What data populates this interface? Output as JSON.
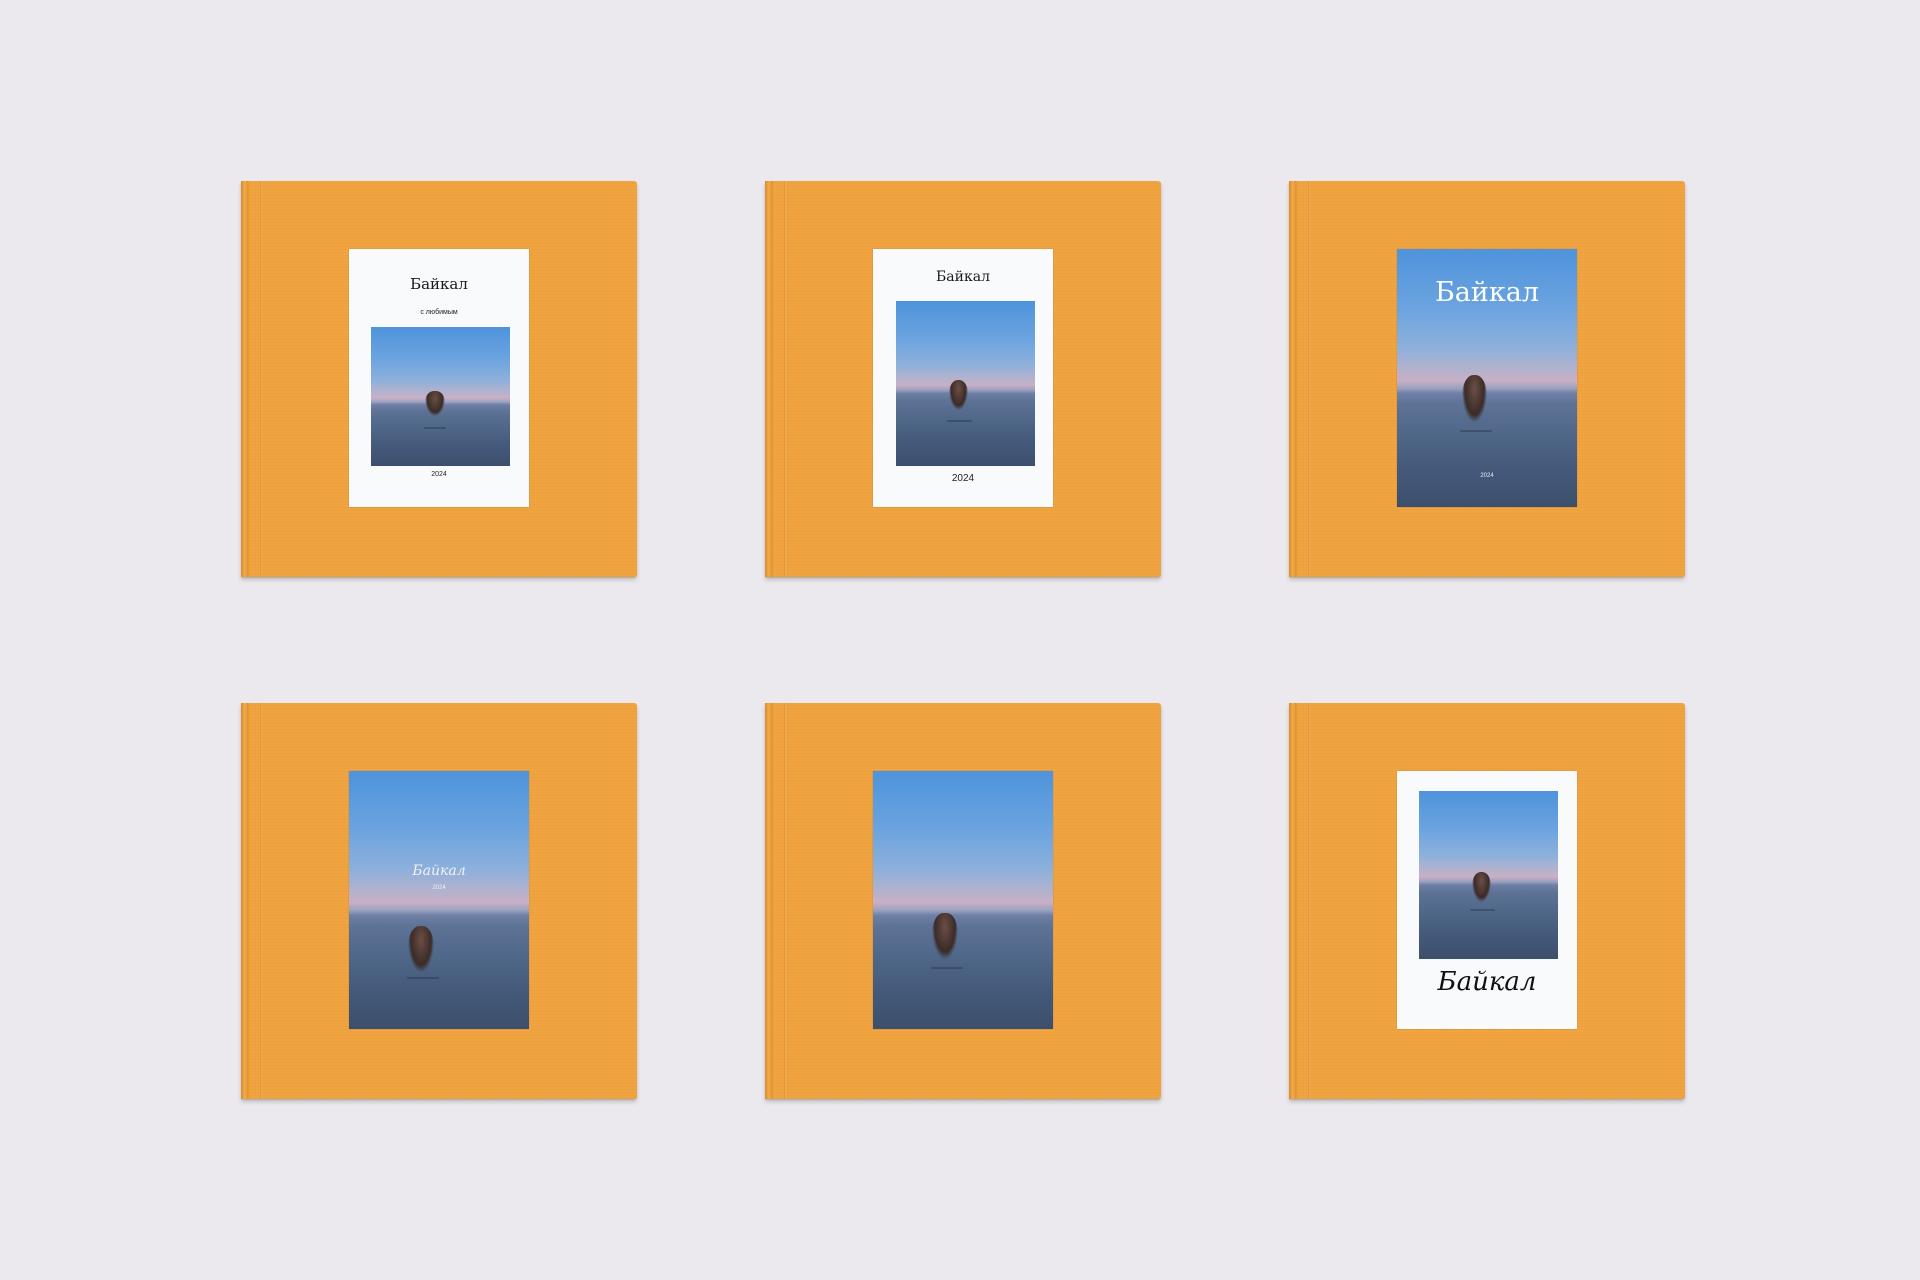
{
  "books": [
    {
      "title": "Байкал",
      "subtitle": "с любимым",
      "year": "2024"
    },
    {
      "title": "Байкал",
      "year": "2024"
    },
    {
      "title": "Байкал",
      "year": "2024"
    },
    {
      "title": "Байкал",
      "year": "2024"
    },
    {},
    {
      "title": "Байкал"
    }
  ],
  "colors": {
    "cover": "#f0a33e",
    "background": "#ebe9ee",
    "card": "#f9fafb"
  }
}
